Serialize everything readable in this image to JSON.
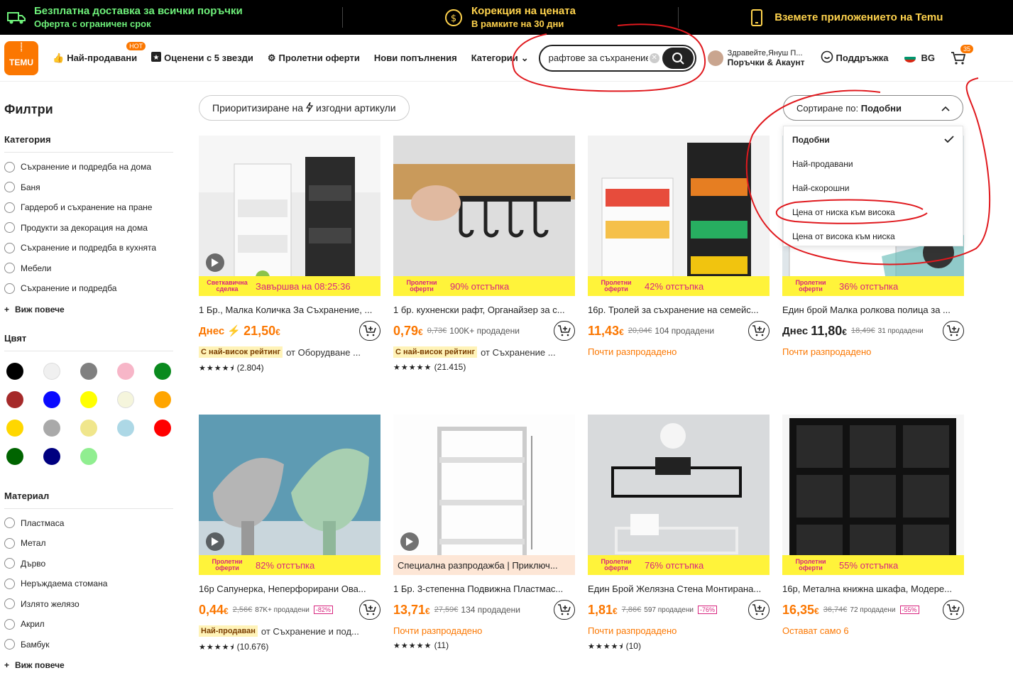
{
  "topbar": {
    "free_ship_title": "Безплатна доставка за всички поръчки",
    "free_ship_sub": "Оферта с ограничен срок",
    "price_adj_title": "Корекция на цената",
    "price_adj_sub": "В рамките на 30 дни",
    "app_text": "Вземете приложението на Temu"
  },
  "header": {
    "logo_top": "ꙶꙶꙶ",
    "logo_text": "TEMU",
    "nav": {
      "bestsellers": "Най-продавани",
      "hot": "HOT",
      "five_star": "Оценени с 5 звезди",
      "spring": "Пролетни оферти",
      "new": "Нови попълнения",
      "categories": "Категории"
    },
    "search_value": "рафтове за съхранение",
    "clear": "✕",
    "greeting": "Здравейте,Януш П...",
    "account": "Поръчки & Акаунт",
    "support": "Поддръжка",
    "lang": "BG",
    "cart_count": "35"
  },
  "sidebar": {
    "title": "Филтри",
    "category_heading": "Категория",
    "categories": [
      "Съхранение и подредба на дома",
      "Баня",
      "Гардероб и съхранение на пране",
      "Продукти за декорация на дома",
      "Съхранение и подредба в кухнята",
      "Мебели",
      "Съхранение и подредба"
    ],
    "see_more": "Виж повече",
    "color_heading": "Цвят",
    "colors": [
      "#000000",
      "#f0f0f0",
      "#808080",
      "#f7b6c8",
      "#0a8a1e",
      "#a52a2a",
      "#0a0aff",
      "#ffff00",
      "#f5f5dc",
      "#ffa500",
      "#ffd700",
      "#a9a9a9",
      "#f0e68c",
      "#add8e6",
      "#ff0000",
      "#006400",
      "#000080",
      "#90ee90"
    ],
    "material_heading": "Материал",
    "materials": [
      "Пластмаса",
      "Метал",
      "Дърво",
      "Неръждаема стомана",
      "Излято желязо",
      "Акрил",
      "Бамбук"
    ],
    "see_more_2": "Виж повече"
  },
  "toolbar": {
    "prioritize_a": "Приоритизиране на",
    "prioritize_b": "изгодни артикули",
    "sort_label": "Сортиране по:",
    "sort_value": "Подобни"
  },
  "sort_options": [
    "Подобни",
    "Най-продавани",
    "Най-скорошни",
    "Цена от ниска към висока",
    "Цена от висока към ниска"
  ],
  "products": [
    {
      "promo_tag": "Светкавична сделка",
      "promo": "Завършва на 08:25:36",
      "title": "1 Бр., Малка Количка За Съхранение, ...",
      "price_prefix": "Днес ⚡",
      "price": "21,50",
      "cur": "€",
      "old": "",
      "sold": "",
      "disc": "",
      "badge": "С най-висок рейтинг",
      "seller": "от Оборудване ...",
      "almost": "",
      "stars": "★★★★⯨",
      "rating": "(2.804)",
      "video": true
    },
    {
      "promo_tag": "Пролетни оферти",
      "promo": "90% отстъпка",
      "title": "1 бр. кухненски рафт, Органайзер за с...",
      "price_prefix": "",
      "price": "0,79",
      "cur": "€",
      "old": "0,73€",
      "sold": "100K+ продадени",
      "disc": "",
      "badge": "С най-висок рейтинг",
      "seller": "от Съхранение ...",
      "almost": "",
      "stars": "★★★★★",
      "rating": "(21.415)",
      "video": false
    },
    {
      "promo_tag": "Пролетни оферти",
      "promo": "42% отстъпка",
      "title": "16р. Тролей за съхранение на семейс...",
      "price_prefix": "",
      "price": "11,43",
      "cur": "€",
      "old": "20,04€",
      "sold": "104 продадени",
      "disc": "",
      "badge": "",
      "seller": "",
      "almost": "Почти разпродадено",
      "stars": "",
      "rating": "",
      "video": false
    },
    {
      "promo_tag": "Пролетни оферти",
      "promo": "36% отстъпка",
      "title": "Един брой Малка ролкова полица за ...",
      "price_prefix": "Днес",
      "price": "11,80",
      "cur": "€",
      "old": "18,49€",
      "sold": "31 продадени",
      "disc": "",
      "badge": "",
      "seller": "",
      "almost": "Почти разпродадено",
      "stars": "",
      "rating": "",
      "video": false
    },
    {
      "promo_tag": "Пролетни оферти",
      "promo": "82% отстъпка",
      "title": "16р Сапунерка, Неперфорирани Ова...",
      "price_prefix": "",
      "price": "0,44",
      "cur": "€",
      "old": "2,56€",
      "sold": "87K+ продадени",
      "disc": "-82%",
      "badge": "Най-продаван",
      "seller": "от Съхранение и под...",
      "almost": "",
      "stars": "★★★★⯨",
      "rating": "(10.676)",
      "video": true
    },
    {
      "promo_tag": "",
      "promo": "Специална разпродажба | Приключ...",
      "title": "1 Бр. 3-степенна Подвижна Пластмас...",
      "price_prefix": "",
      "price": "13,71",
      "cur": "€",
      "old": "27,59€",
      "sold": "134 продадени",
      "disc": "",
      "badge": "",
      "seller": "",
      "almost": "Почти разпродадено",
      "stars": "★★★★★",
      "rating": "(11)",
      "video": true
    },
    {
      "promo_tag": "Пролетни оферти",
      "promo": "76% отстъпка",
      "title": "Един Брой Желязна Стена Монтирана...",
      "price_prefix": "",
      "price": "1,81",
      "cur": "€",
      "old": "7,86€",
      "sold": "597 продадени",
      "disc": "-76%",
      "badge": "",
      "seller": "",
      "almost": "Почти разпродадено",
      "stars": "★★★★⯨",
      "rating": "(10)",
      "video": false
    },
    {
      "promo_tag": "Пролетни оферти",
      "promo": "55% отстъпка",
      "title": "16р, Метална книжна шкафа, Модере...",
      "price_prefix": "",
      "price": "16,35",
      "cur": "€",
      "old": "36,74€",
      "sold": "72 продадени",
      "disc": "-55%",
      "badge": "",
      "seller": "",
      "almost": "Остават само 6",
      "stars": "",
      "rating": "",
      "video": false
    }
  ]
}
